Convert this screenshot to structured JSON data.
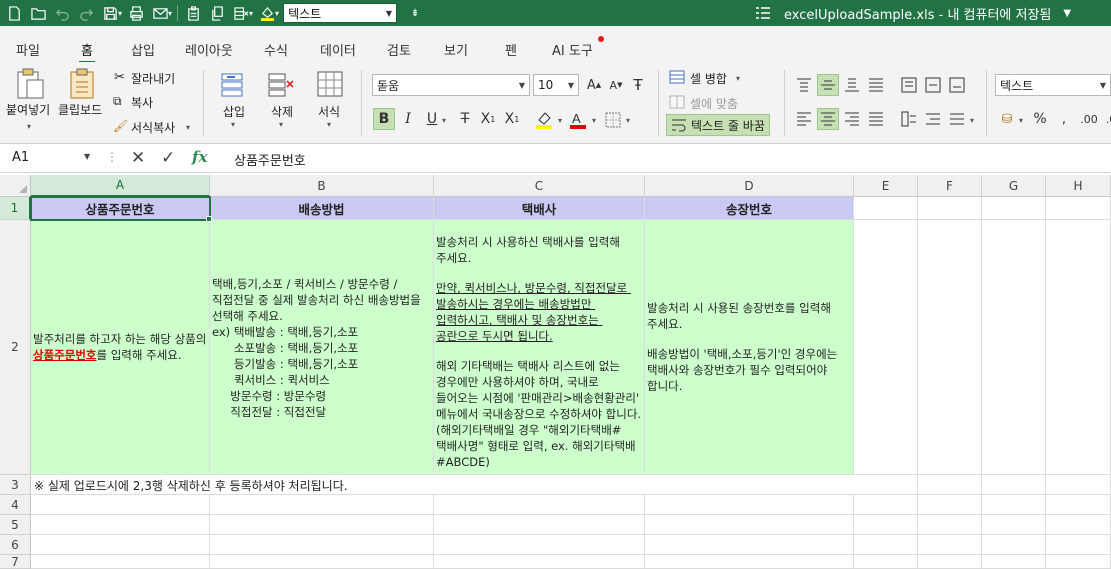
{
  "titlebar": {
    "style_value": "텍스트",
    "file_title": "excelUploadSample.xls - 내 컴퓨터에 저장됨",
    "bg_color": "#217346"
  },
  "tabs": [
    {
      "label": "파일",
      "active": false
    },
    {
      "label": "홈",
      "active": true
    },
    {
      "label": "삽입",
      "active": false
    },
    {
      "label": "레이아웃",
      "active": false
    },
    {
      "label": "수식",
      "active": false
    },
    {
      "label": "데이터",
      "active": false
    },
    {
      "label": "검토",
      "active": false
    },
    {
      "label": "보기",
      "active": false
    },
    {
      "label": "펜",
      "active": false
    },
    {
      "label": "AI 도구",
      "active": false
    }
  ],
  "ribbon": {
    "paste_label": "붙여넣기",
    "clipboard_label": "클립보드",
    "cut_label": "잘라내기",
    "copy_label": "복사",
    "format_painter_label": "서식복사",
    "insert_label": "삽입",
    "delete_label": "삭제",
    "format_label": "서식",
    "font_name": "돋움",
    "font_size": "10",
    "merge_label": "셀 병합",
    "fit_label": "셀에 맞춤",
    "wrap_label": "텍스트 줄 바꿈",
    "number_format": "텍스트",
    "accent_color": "#217346"
  },
  "formula_bar": {
    "name_box": "A1",
    "content": "상품주문번호"
  },
  "sheet": {
    "columns": [
      "A",
      "B",
      "C",
      "D",
      "E",
      "F",
      "G",
      "H"
    ],
    "rows": [
      "1",
      "2",
      "3",
      "4",
      "5",
      "6",
      "7"
    ],
    "selected_cell": "A1",
    "header_fill": "#c9c9f4",
    "body_fill": "#ccffcc",
    "row1": {
      "a": "상품주문번호",
      "b": "배송방법",
      "c": "택배사",
      "d": "송장번호"
    },
    "row2": {
      "a_pre": "발주처리를 하고자 하는 해당 상품의 ",
      "a_red": "상품주문번호",
      "a_post": "를 입력해 주세요.",
      "b_lines": [
        "택배,등기,소포 / 퀵서비스 / 방문수령 / 직접전달 중 실제 발송처리 하신 배송방법을 선택해 주세요.",
        "ex) 택배발송 : 택배,등기,소포",
        "      소포발송 : 택배,등기,소포",
        "      등기발송 : 택배,등기,소포",
        "      퀵서비스 : 퀵서비스",
        "     방문수령 : 방문수령",
        "     직접전달 : 직접전달"
      ],
      "c_p1": "발송처리 시 사용하신 택배사를 입력해 주세요.",
      "c_p2": "만약, 퀵서비스나, 방문수령, 직접전달로 발송하시는 경우에는 배송방법만 입력하시고, 택배사 및 송장번호는 공란으로 두시면 됩니다.",
      "c_p3": "해외 기타택배는 택배사 리스트에 없는 경우에만 사용하셔야 하며, 국내로 들어오는 시점에 '판매관리>배송현황관리' 메뉴에서 국내송장으로 수정하셔야 합니다. (해외기타택배일 경우 \"해외기타택배#택배사명\" 형태로 입력, ex. 해외기타택배#ABCDE)",
      "d_p1": "발송처리 시 사용된 송장번호를 입력해 주세요.",
      "d_p2": "배송방법이 '택배,소포,등기'인 경우에는 택배사와 송장번호가 필수 입력되어야 합니다."
    },
    "row3": {
      "a": "※ 실제 업로드시에 2,3행 삭제하신 후 등록하셔야 처리됩니다."
    }
  }
}
